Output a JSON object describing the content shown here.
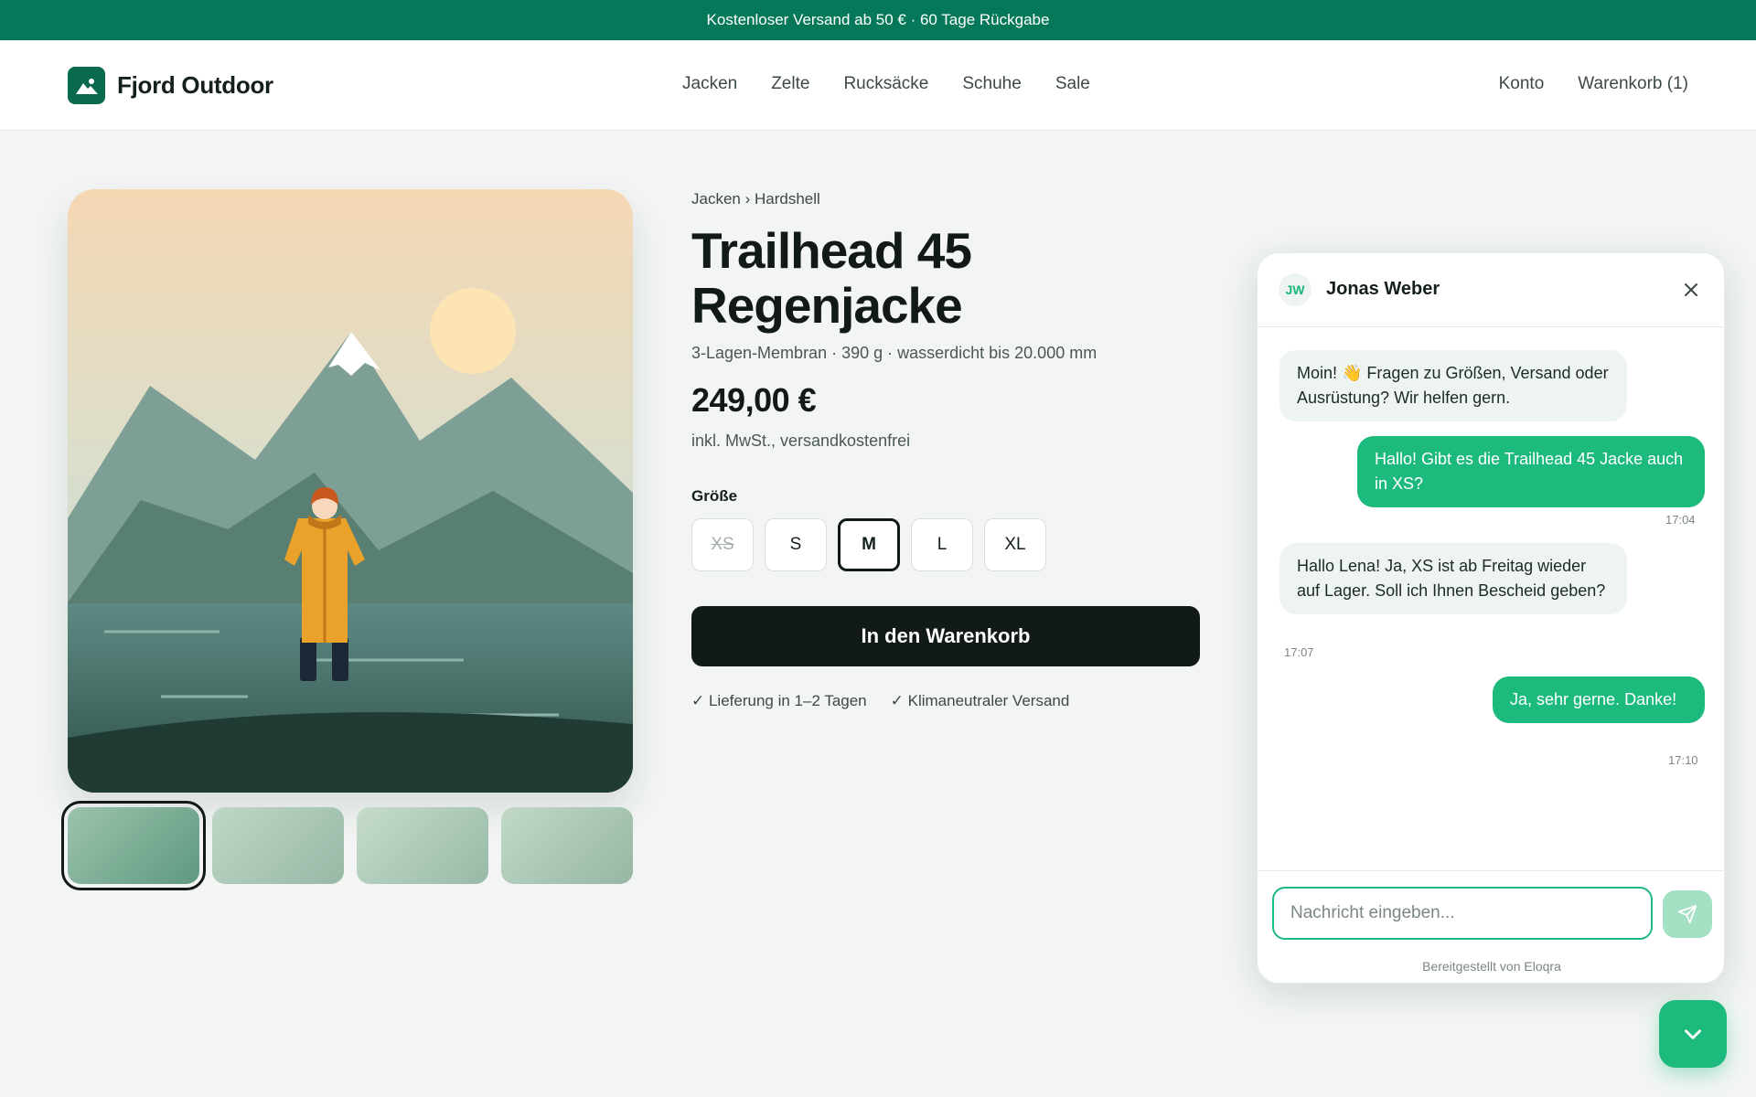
{
  "promo_bar": {
    "text": "Kostenloser Versand ab 50 € · 60 Tage Rückgabe"
  },
  "header": {
    "brand": "Fjord Outdoor",
    "logo_icon": "mountain-icon",
    "nav": [
      "Jacken",
      "Zelte",
      "Rucksäcke",
      "Schuhe",
      "Sale"
    ],
    "account_label": "Konto",
    "cart_label": "Warenkorb (1)"
  },
  "product": {
    "breadcrumb": "Jacken › Hardshell",
    "title": "Trailhead 45 Regenjacke",
    "specs": "3-Lagen-Membran · 390 g · wasserdicht bis 20.000 mm",
    "price": "249,00 €",
    "tax_note": "inkl. MwSt., versandkostenfrei",
    "size_label": "Größe",
    "sizes": [
      "XS",
      "S",
      "M",
      "L",
      "XL"
    ],
    "size_selected": "M",
    "size_unavailable": "XS",
    "add_to_cart": "In den Warenkorb",
    "perks": [
      "✓ Lieferung in 1–2 Tagen",
      "✓ Klimaneutraler Versand"
    ],
    "thumbnails_active": 1
  },
  "chat": {
    "agent_initials": "JW",
    "agent_name": "Jonas Weber",
    "close_icon": "close-icon",
    "messages": [
      {
        "from": "agent",
        "text": "Moin! 👋 Fragen zu Größen, Versand oder Ausrüstung? Wir helfen gern.",
        "time": ""
      },
      {
        "from": "user",
        "text": "Hallo! Gibt es die Trailhead 45 Jacke auch in XS?",
        "time": "17:04"
      },
      {
        "from": "agent",
        "text": "Hallo Lena! Ja, XS ist ab Freitag wieder auf Lager. Soll ich Ihnen Bescheid geben?",
        "time": "17:07"
      },
      {
        "from": "user",
        "text": "Ja, sehr gerne. Danke!",
        "time": "17:10"
      }
    ],
    "input_placeholder": "Nachricht eingeben...",
    "send_icon": "send-icon",
    "powered_by": "Bereitgestellt von Eloqra"
  },
  "fab_icon": "chevron-down-icon",
  "colors": {
    "brand_green": "#06785a",
    "accent": "#1dba7e",
    "dark": "#111a16"
  }
}
